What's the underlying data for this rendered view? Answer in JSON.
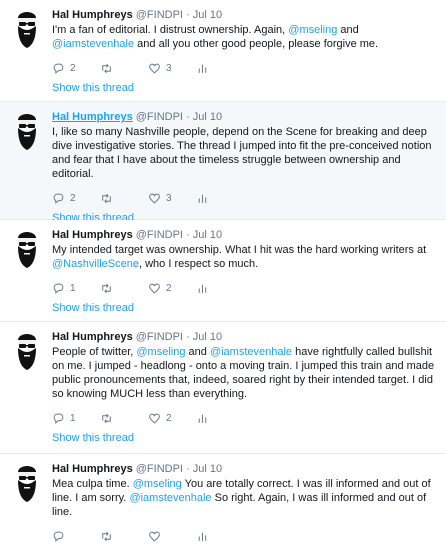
{
  "colors": {
    "accent": "#1da1f2",
    "muted": "#657786",
    "text": "#14171a",
    "highlight_bg": "#f5f8fa"
  },
  "icons": {
    "reply": "reply-icon",
    "retweet": "retweet-icon",
    "like": "heart-icon",
    "analytics": "analytics-icon"
  },
  "tweets": [
    {
      "name": "Hal Humphreys",
      "handle": "@FINDPI",
      "sep": "·",
      "date": "Jul 10",
      "segments": [
        {
          "text": "I'm a fan of editorial. I distrust ownership. Again, ",
          "mention": false
        },
        {
          "text": "@mseling",
          "mention": true
        },
        {
          "text": " and ",
          "mention": false
        },
        {
          "text": "@iamstevenhale",
          "mention": true
        },
        {
          "text": " and all you other good people, please forgive me.",
          "mention": false
        }
      ],
      "reply_count": "2",
      "retweet_count": "",
      "like_count": "3",
      "show_thread": "Show this thread"
    },
    {
      "name": "Hal Humphreys",
      "handle": "@FINDPI",
      "sep": "·",
      "date": "Jul 10",
      "segments": [
        {
          "text": "I, like so many Nashville people, depend on the Scene for breaking and deep dive investigative stories. The thread I jumped into fit the pre-conceived notion and fear that I have about the timeless struggle between ownership and editorial.",
          "mention": false
        }
      ],
      "reply_count": "2",
      "retweet_count": "",
      "like_count": "3",
      "show_thread": "Show this thread"
    },
    {
      "name": "Hal Humphreys",
      "handle": "@FINDPI",
      "sep": "·",
      "date": "Jul 10",
      "segments": [
        {
          "text": "My intended target was ownership. What I hit was the hard working writers at ",
          "mention": false
        },
        {
          "text": "@NashvilleScene",
          "mention": true
        },
        {
          "text": ", who I respect so much.",
          "mention": false
        }
      ],
      "reply_count": "1",
      "retweet_count": "",
      "like_count": "2",
      "show_thread": "Show this thread"
    },
    {
      "name": "Hal Humphreys",
      "handle": "@FINDPI",
      "sep": "·",
      "date": "Jul 10",
      "segments": [
        {
          "text": "People of twitter, ",
          "mention": false
        },
        {
          "text": "@mseling",
          "mention": true
        },
        {
          "text": " and ",
          "mention": false
        },
        {
          "text": "@iamstevenhale",
          "mention": true
        },
        {
          "text": " have rightfully called bullshit on me. I jumped - headlong - onto a moving train. I jumped this train and made public pronouncements that, indeed, soared right by their intended target. I did so knowing MUCH less than everything.",
          "mention": false
        }
      ],
      "reply_count": "1",
      "retweet_count": "",
      "like_count": "2",
      "show_thread": "Show this thread"
    },
    {
      "name": "Hal Humphreys",
      "handle": "@FINDPI",
      "sep": "·",
      "date": "Jul 10",
      "segments": [
        {
          "text": "Mea culpa time. ",
          "mention": false
        },
        {
          "text": "@mseling",
          "mention": true
        },
        {
          "text": " You are totally correct. I was ill informed and out of line. I am sorry. ",
          "mention": false
        },
        {
          "text": "@iamstevenhale",
          "mention": true
        },
        {
          "text": " So right. Again, I was ill informed and out of line.",
          "mention": false
        }
      ],
      "reply_count": "",
      "retweet_count": "",
      "like_count": "",
      "show_thread": ""
    }
  ]
}
